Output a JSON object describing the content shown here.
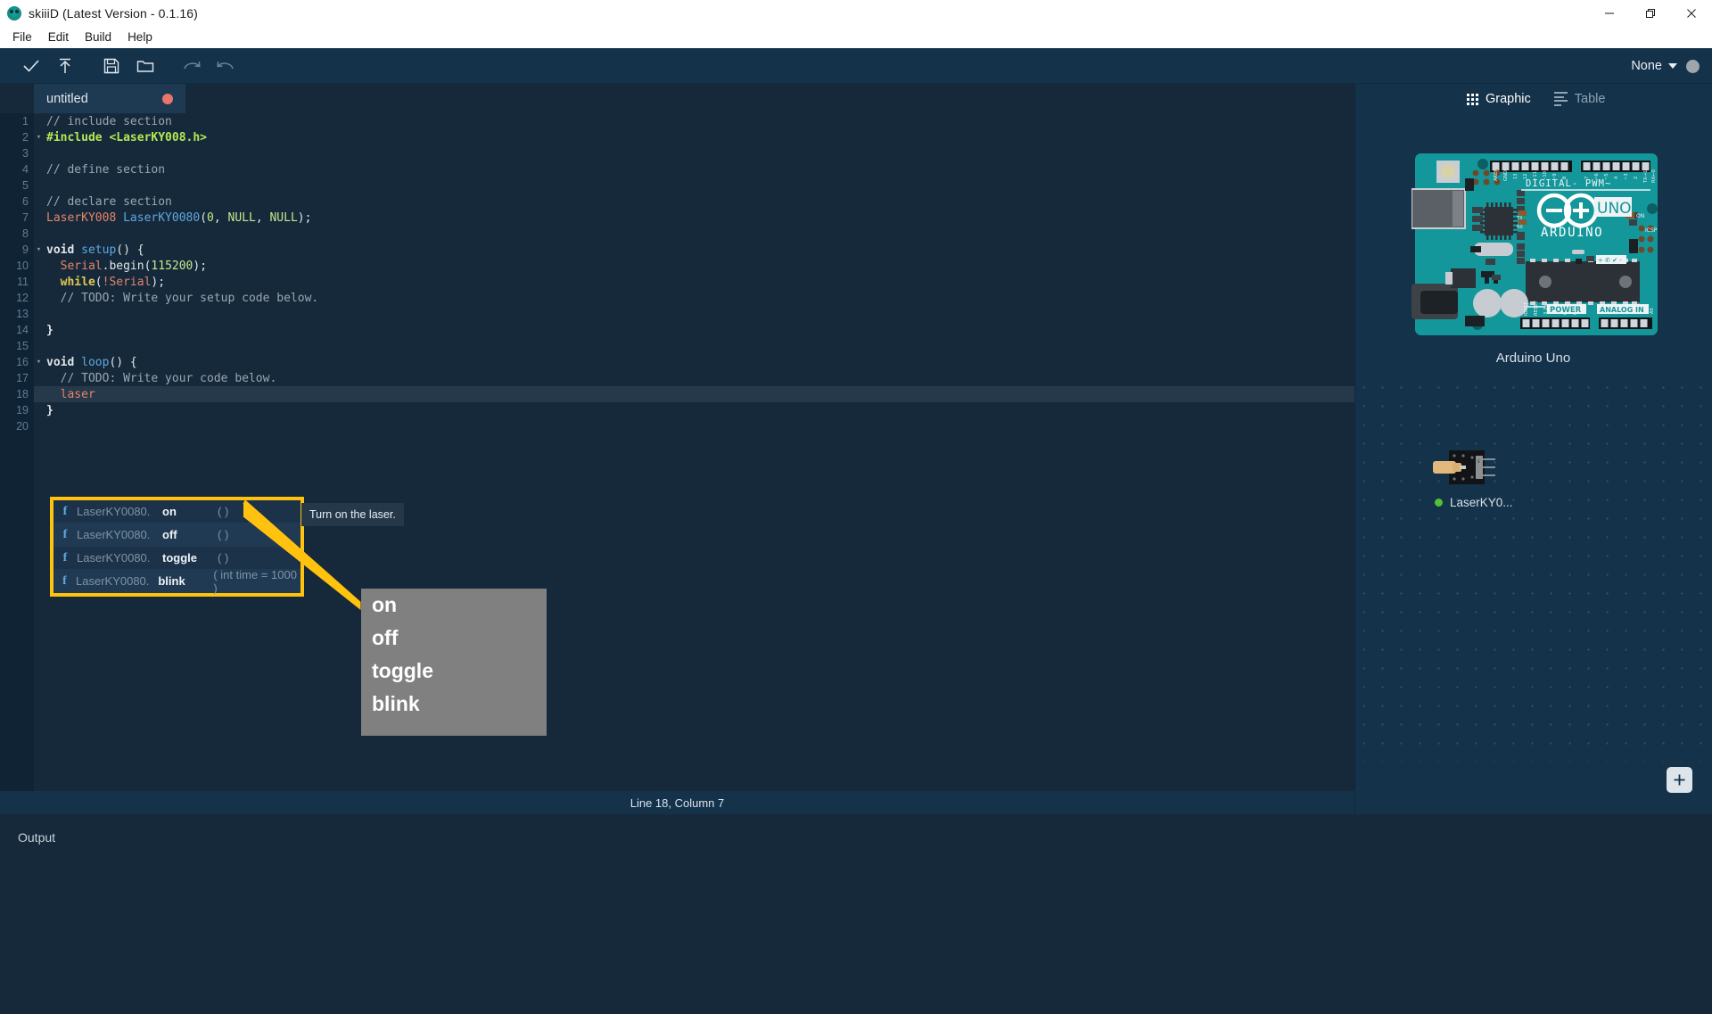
{
  "window": {
    "title": "skiiiD (Latest Version - 0.1.16)",
    "logo_icon": "skiiid-logo-icon",
    "minimize_icon": "minimize-icon",
    "maximize_icon": "maximize-icon",
    "close_icon": "close-icon"
  },
  "menubar": {
    "items": [
      {
        "label": "File"
      },
      {
        "label": "Edit"
      },
      {
        "label": "Build"
      },
      {
        "label": "Help"
      }
    ]
  },
  "toolbar": {
    "buttons": [
      {
        "name": "verify-button",
        "icon": "check-icon"
      },
      {
        "name": "upload-button",
        "icon": "upload-arrow-icon"
      },
      {
        "name": "save-button",
        "icon": "floppy-disk-icon"
      },
      {
        "name": "open-folder-button",
        "icon": "folder-icon"
      },
      {
        "name": "redo-button",
        "icon": "redo-arrow-icon"
      },
      {
        "name": "undo-button",
        "icon": "undo-arrow-icon"
      }
    ],
    "port_select": {
      "label": "None",
      "caret_icon": "chevron-down-icon",
      "status_dot_color": "#9ea6ad"
    }
  },
  "editor": {
    "tab": {
      "label": "untitled",
      "modified_dot_color": "#e8766b"
    },
    "lines": [
      {
        "n": "1",
        "fold": false,
        "tokens": [
          {
            "t": "// include section",
            "c": "c-cmt"
          }
        ]
      },
      {
        "n": "2",
        "fold": true,
        "tokens": [
          {
            "t": "#include <LaserKY008.h>",
            "c": "c-pre"
          }
        ]
      },
      {
        "n": "3",
        "fold": false,
        "tokens": [
          {
            "t": "",
            "c": "c-plain"
          }
        ]
      },
      {
        "n": "4",
        "fold": false,
        "tokens": [
          {
            "t": "// define section",
            "c": "c-cmt"
          }
        ]
      },
      {
        "n": "5",
        "fold": false,
        "tokens": [
          {
            "t": "",
            "c": "c-plain"
          }
        ]
      },
      {
        "n": "6",
        "fold": false,
        "tokens": [
          {
            "t": "// declare section",
            "c": "c-cmt"
          }
        ]
      },
      {
        "n": "7",
        "fold": false,
        "tokens": [
          {
            "t": "LaserKY008 ",
            "c": "c-type"
          },
          {
            "t": "LaserKY0080",
            "c": "c-fn"
          },
          {
            "t": "(",
            "c": "c-punct"
          },
          {
            "t": "0",
            "c": "c-num"
          },
          {
            "t": ", ",
            "c": "c-punct"
          },
          {
            "t": "NULL",
            "c": "c-num"
          },
          {
            "t": ", ",
            "c": "c-punct"
          },
          {
            "t": "NULL",
            "c": "c-num"
          },
          {
            "t": ");",
            "c": "c-punct"
          }
        ]
      },
      {
        "n": "8",
        "fold": false,
        "tokens": [
          {
            "t": "",
            "c": "c-plain"
          }
        ]
      },
      {
        "n": "9",
        "fold": true,
        "tokens": [
          {
            "t": "void ",
            "c": "c-plain"
          },
          {
            "t": "setup",
            "c": "c-fn"
          },
          {
            "t": "() {",
            "c": "c-punct"
          }
        ]
      },
      {
        "n": "10",
        "fold": false,
        "tokens": [
          {
            "t": "  Serial",
            "c": "c-obj"
          },
          {
            "t": ".begin",
            "c": "c-punct"
          },
          {
            "t": "(",
            "c": "c-punct"
          },
          {
            "t": "115200",
            "c": "c-num"
          },
          {
            "t": ");",
            "c": "c-punct"
          }
        ]
      },
      {
        "n": "11",
        "fold": false,
        "tokens": [
          {
            "t": "  while",
            "c": "c-kw"
          },
          {
            "t": "(",
            "c": "c-punct"
          },
          {
            "t": "!Serial",
            "c": "c-var"
          },
          {
            "t": ");",
            "c": "c-punct"
          }
        ]
      },
      {
        "n": "12",
        "fold": false,
        "tokens": [
          {
            "t": "  // TODO: Write your setup code below.",
            "c": "c-cmt"
          }
        ]
      },
      {
        "n": "13",
        "fold": false,
        "tokens": [
          {
            "t": "",
            "c": "c-plain"
          }
        ]
      },
      {
        "n": "14",
        "fold": false,
        "tokens": [
          {
            "t": "}",
            "c": "c-plain"
          }
        ]
      },
      {
        "n": "15",
        "fold": false,
        "tokens": [
          {
            "t": "",
            "c": "c-plain"
          }
        ]
      },
      {
        "n": "16",
        "fold": true,
        "tokens": [
          {
            "t": "void ",
            "c": "c-plain"
          },
          {
            "t": "loop",
            "c": "c-fn"
          },
          {
            "t": "() {",
            "c": "c-punct"
          }
        ]
      },
      {
        "n": "17",
        "fold": false,
        "tokens": [
          {
            "t": "  // TODO: Write your code below.",
            "c": "c-cmt"
          }
        ]
      },
      {
        "n": "18",
        "fold": false,
        "highlight": true,
        "tokens": [
          {
            "t": "  laser",
            "c": "c-var"
          }
        ]
      },
      {
        "n": "19",
        "fold": false,
        "tokens": [
          {
            "t": "}",
            "c": "c-plain"
          }
        ]
      },
      {
        "n": "20",
        "fold": false,
        "tokens": [
          {
            "t": "",
            "c": "c-plain"
          }
        ]
      }
    ],
    "autocomplete": {
      "border_color": "#ffc20e",
      "items": [
        {
          "kind": "f",
          "owner": "LaserKY0080.",
          "name": "on",
          "args": "( )"
        },
        {
          "kind": "f",
          "owner": "LaserKY0080.",
          "name": "off",
          "args": "( )"
        },
        {
          "kind": "f",
          "owner": "LaserKY0080.",
          "name": "toggle",
          "args": "( )"
        },
        {
          "kind": "f",
          "owner": "LaserKY0080.",
          "name": "blink",
          "args": "( int time = 1000 )"
        }
      ],
      "tooltip": "Turn on the laser."
    },
    "callout": {
      "items": [
        "on",
        "off",
        "toggle",
        "blink"
      ],
      "background": "#808080",
      "connector_color": "#ffc20e"
    },
    "statusbar": {
      "text": "Line 18, Column 7"
    }
  },
  "output": {
    "label": "Output"
  },
  "right_panel": {
    "tabs": [
      {
        "label": "Graphic",
        "icon": "grid-icon",
        "active": true
      },
      {
        "label": "Table",
        "icon": "table-lines-icon",
        "active": false
      }
    ],
    "board": {
      "name": "Arduino Uno",
      "brand": "ARDUINO",
      "model": "UNO",
      "labels": {
        "digital": "DIGITAL",
        "pwm": "- PWM~",
        "power": "POWER",
        "analog": "ANALOG IN",
        "on": "ON",
        "tx": "TX",
        "rx": "RX",
        "icsp": "ICSP",
        "digital_pins": [
          "AREF",
          "GND",
          "13",
          "12",
          "~11",
          "~10",
          "~9",
          "8"
        ],
        "digital_pins_right": [
          "7",
          "~6",
          "~5",
          "4",
          "~3",
          "2",
          "TX→1",
          "RX←0"
        ],
        "power_pins": [
          "IOREF",
          "RESET",
          "3.3V",
          "5V",
          "GND",
          "GND",
          "Vin"
        ],
        "analog_pins": [
          "A0",
          "A1",
          "A2",
          "A3",
          "A4",
          "A5"
        ]
      }
    },
    "component": {
      "name": "LaserKY0...",
      "status_dot_color": "#52c234"
    },
    "add_button": {
      "icon": "plus-icon"
    }
  }
}
